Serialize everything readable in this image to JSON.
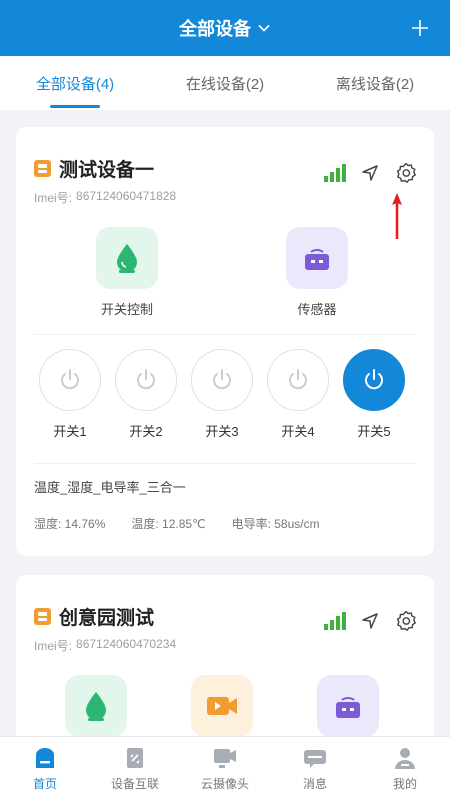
{
  "header": {
    "title": "全部设备"
  },
  "tabs": [
    {
      "label": "全部设备(4)",
      "active": true
    },
    {
      "label": "在线设备(2)",
      "active": false
    },
    {
      "label": "离线设备(2)",
      "active": false
    }
  ],
  "devices": [
    {
      "name": "测试设备一",
      "imei_label": "Imei号:",
      "imei": "867124060471828",
      "functions": [
        {
          "label": "开关控制",
          "icon": "water-drop-icon"
        },
        {
          "label": "传感器",
          "icon": "radio-sensor-icon"
        }
      ],
      "switches": [
        {
          "label": "开关1",
          "on": false
        },
        {
          "label": "开关2",
          "on": false
        },
        {
          "label": "开关3",
          "on": false
        },
        {
          "label": "开关4",
          "on": false
        },
        {
          "label": "开关5",
          "on": true
        }
      ],
      "sensor_name": "温度_湿度_电导率_三合一",
      "readings": {
        "humidity": "湿度: 14.76%",
        "temperature": "温度: 12.85℃",
        "conductivity": "电导率: 58us/cm"
      }
    },
    {
      "name": "创意园测试",
      "imei_label": "Imei号:",
      "imei": "867124060470234",
      "functions": [
        {
          "icon": "water-drop-icon"
        },
        {
          "icon": "video-camera-icon"
        },
        {
          "icon": "radio-sensor-icon"
        }
      ]
    }
  ],
  "tabbar": [
    {
      "label": "首页",
      "icon": "home-icon",
      "active": true
    },
    {
      "label": "设备互联",
      "icon": "device-link-icon",
      "active": false
    },
    {
      "label": "云摄像头",
      "icon": "camera-icon",
      "active": false
    },
    {
      "label": "消息",
      "icon": "message-icon",
      "active": false
    },
    {
      "label": "我的",
      "icon": "profile-icon",
      "active": false
    }
  ],
  "colors": {
    "primary": "#1388d8",
    "signal": "#3db13b",
    "device_badge": "#f29b30",
    "annotation_arrow": "#e02020"
  }
}
